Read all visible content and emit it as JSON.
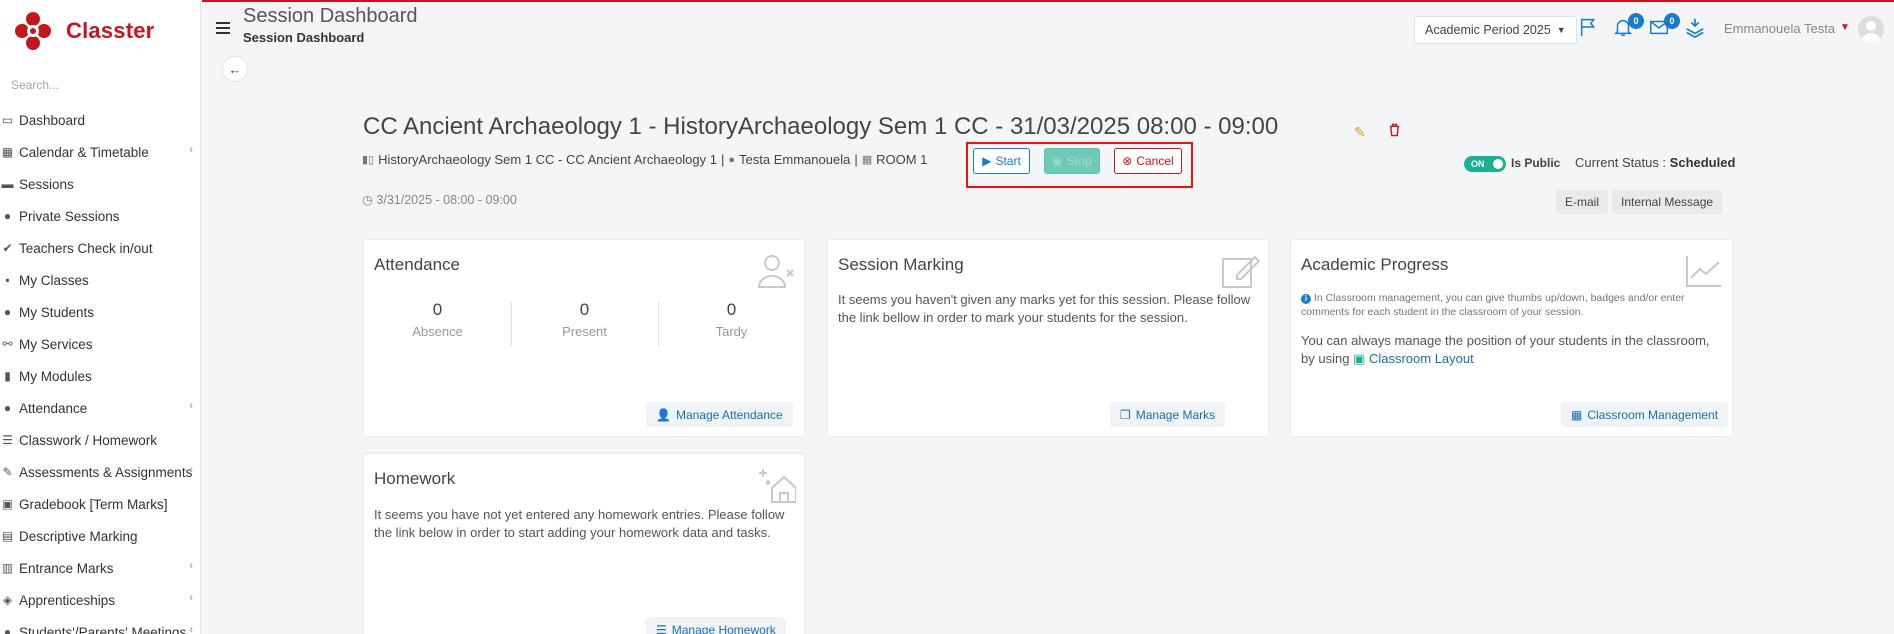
{
  "brand": {
    "name": "Classter",
    "color": "#c4161c"
  },
  "search": {
    "placeholder": "Search..."
  },
  "sidebar": {
    "items": [
      {
        "label": "Dashboard",
        "icon": "laptop-icon",
        "chevron": false
      },
      {
        "label": "Calendar & Timetable",
        "icon": "calendar-icon",
        "chevron": true
      },
      {
        "label": "Sessions",
        "icon": "sessions-icon",
        "chevron": false
      },
      {
        "label": "Private Sessions",
        "icon": "users-icon",
        "chevron": false
      },
      {
        "label": "Teachers Check in/out",
        "icon": "check-icon",
        "chevron": false
      },
      {
        "label": "My Classes",
        "icon": "classes-icon",
        "chevron": false
      },
      {
        "label": "My Students",
        "icon": "students-icon",
        "chevron": false
      },
      {
        "label": "My Services",
        "icon": "services-icon",
        "chevron": false
      },
      {
        "label": "My Modules",
        "icon": "book-icon",
        "chevron": false
      },
      {
        "label": "Attendance",
        "icon": "attendance-icon",
        "chevron": true
      },
      {
        "label": "Classwork / Homework",
        "icon": "list-icon",
        "chevron": false
      },
      {
        "label": "Assessments & Assignments",
        "icon": "edit-icon",
        "chevron": true
      },
      {
        "label": "Gradebook [Term Marks]",
        "icon": "gradebook-icon",
        "chevron": false
      },
      {
        "label": "Descriptive Marking",
        "icon": "marking-icon",
        "chevron": false
      },
      {
        "label": "Entrance Marks",
        "icon": "entrance-icon",
        "chevron": true
      },
      {
        "label": "Apprenticeships",
        "icon": "box-icon",
        "chevron": true
      },
      {
        "label": "Students'/Parents' Meetings",
        "icon": "meeting-icon",
        "chevron": true
      }
    ]
  },
  "header": {
    "title": "Session Dashboard",
    "breadcrumb": "Session Dashboard",
    "academic_period": "Academic Period 2025",
    "notifications_count": "0",
    "messages_count": "0",
    "user_name": "Emmanouela Testa"
  },
  "session": {
    "title": "CC Ancient Archaeology 1 - HistoryArchaeology Sem 1 CC - 31/03/2025 08:00 - 09:00",
    "course": "HistoryArchaeology Sem 1 CC - CC Ancient Archaeology 1",
    "teacher": "Testa Emmanouela",
    "room": "ROOM 1",
    "sep": "|",
    "datetime": "3/31/2025 - 08:00 - 09:00",
    "start_label": "Start",
    "stop_label": "Stop",
    "cancel_label": "Cancel",
    "toggle_label": "ON",
    "is_public_label": "Is Public",
    "status_label": "Current Status :",
    "status_value": "Scheduled",
    "email_label": "E-mail",
    "internal_message_label": "Internal Message"
  },
  "cards": {
    "attendance": {
      "title": "Attendance",
      "stats": [
        {
          "value": "0",
          "label": "Absence"
        },
        {
          "value": "0",
          "label": "Present"
        },
        {
          "value": "0",
          "label": "Tardy"
        }
      ],
      "button": "Manage Attendance"
    },
    "marking": {
      "title": "Session Marking",
      "text": "It seems you haven't given any marks yet for this session. Please follow the link bellow in order to mark your students for the session.",
      "button": "Manage Marks"
    },
    "progress": {
      "title": "Academic Progress",
      "note": "In Classroom management, you can give thumbs up/down, badges and/or enter comments for each student in the classroom of your session.",
      "text": "You can always manage the position of your students in the classroom, by using",
      "link": "Classroom Layout",
      "button": "Classroom Management"
    },
    "homework": {
      "title": "Homework",
      "text": "It seems you have not yet entered any homework entries. Please follow the link below in order to start adding your homework data and tasks.",
      "button": "Manage Homework"
    }
  },
  "colors": {
    "accent": "#1a7bc8",
    "danger": "#c4161c",
    "success": "#1bb093"
  }
}
